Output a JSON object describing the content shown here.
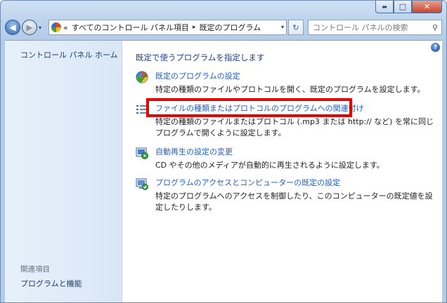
{
  "window": {
    "caption_buttons": {
      "minimize": "▬",
      "maximize": "□",
      "close": "✕"
    }
  },
  "toolbar": {
    "back_glyph": "◀",
    "forward_glyph": "▶",
    "history_glyph": "▾",
    "address": {
      "prefix": "«",
      "crumbs": [
        "すべてのコントロール パネル項目",
        "既定のプログラム"
      ],
      "separator": "▸",
      "dropdown_glyph": "▾"
    },
    "refresh_glyph": "↻",
    "search": {
      "placeholder": "コントロール パネルの検索",
      "icon_glyph": "⚲"
    }
  },
  "sidebar": {
    "home": "コントロール パネル ホーム",
    "related_title": "関連項目",
    "related_items": [
      "プログラムと機能"
    ]
  },
  "main": {
    "help_glyph": "?",
    "heading": "既定で使うプログラムを指定します",
    "tasks": [
      {
        "icon": "default-programs-icon",
        "link": "既定のプログラムの設定",
        "desc": "特定の種類のファイルやプロトコルを開く、既定のプログラムを設定します。"
      },
      {
        "icon": "file-association-icon",
        "link": "ファイルの種類またはプロトコルのプログラムへの関連付け",
        "desc": "特定の種類のファイルまたはプロトコル (.mp3 または http:// など) を常に同じプログラムで開くように設定します。"
      },
      {
        "icon": "autoplay-icon",
        "link": "自動再生の設定の変更",
        "desc": "CD やその他のメディアが自動的に再生されるように設定します。"
      },
      {
        "icon": "program-access-icon",
        "link": "プログラムのアクセスとコンピューターの既定の設定",
        "desc": "特定のプログラムへのアクセスを制御したり、このコンピューターの既定値を設定したりします。"
      }
    ]
  },
  "colors": {
    "link": "#1f5fc9",
    "highlight": "#e60000"
  }
}
